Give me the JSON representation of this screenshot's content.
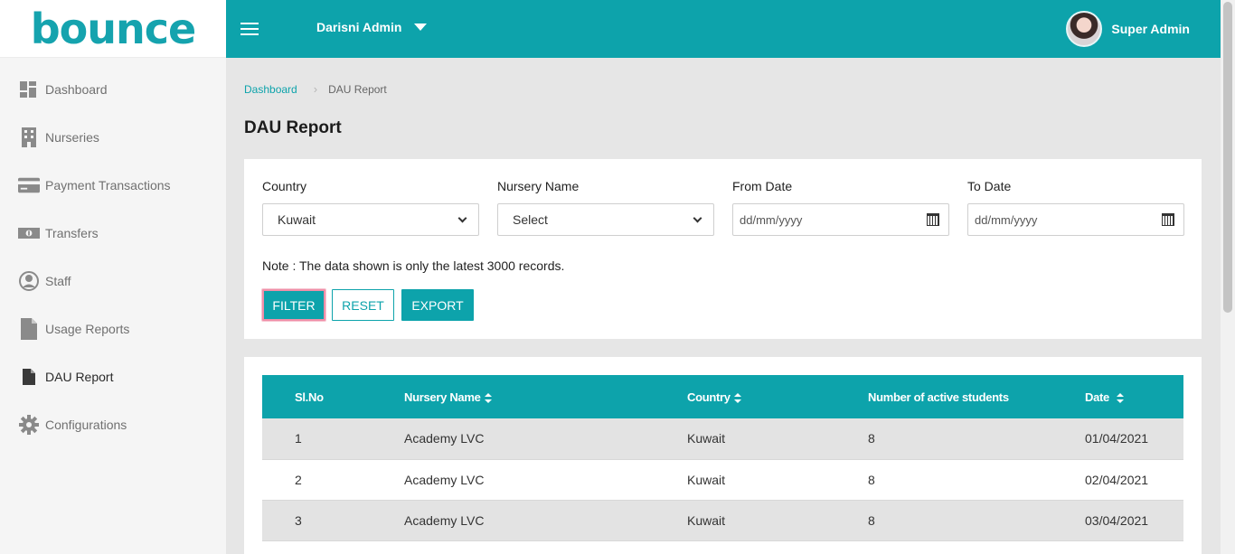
{
  "brand": {
    "logo_text": "bounce",
    "logo_color": "#15a3ae",
    "logo_dot_color": "#8cc63f"
  },
  "colors": {
    "primary": "#0da3ab",
    "sidebar_bg": "#f5f5f5",
    "page_bg": "#e6e6e6"
  },
  "sidebar": {
    "items": [
      {
        "label": "Dashboard",
        "icon": "dashboard-icon"
      },
      {
        "label": "Nurseries",
        "icon": "building-icon"
      },
      {
        "label": "Payment Transactions",
        "icon": "credit-card-icon"
      },
      {
        "label": "Transfers",
        "icon": "money-bill-icon"
      },
      {
        "label": "Staff",
        "icon": "user-circle-icon"
      },
      {
        "label": "Usage Reports",
        "icon": "file-icon"
      },
      {
        "label": "DAU Report",
        "icon": "file-icon",
        "active": true
      },
      {
        "label": "Configurations",
        "icon": "gear-icon"
      }
    ]
  },
  "topbar": {
    "org_name": "Darisni Admin",
    "user_name": "Super Admin"
  },
  "breadcrumb": {
    "home": "Dashboard",
    "current": "DAU Report"
  },
  "page": {
    "title": "DAU Report"
  },
  "filters": {
    "country": {
      "label": "Country",
      "value": "Kuwait"
    },
    "nursery": {
      "label": "Nursery Name",
      "value": "Select"
    },
    "from_date": {
      "label": "From Date",
      "placeholder": "dd/mm/yyyy"
    },
    "to_date": {
      "label": "To Date",
      "placeholder": "dd/mm/yyyy"
    },
    "note": "Note : The data shown is only the latest 3000 records.",
    "buttons": {
      "filter": "FILTER",
      "reset": "RESET",
      "export": "EXPORT"
    }
  },
  "table": {
    "headers": [
      "Sl.No",
      "Nursery Name",
      "Country",
      "Number of active students",
      "Date"
    ],
    "rows": [
      [
        "1",
        "Academy LVC",
        "Kuwait",
        "8",
        "01/04/2021"
      ],
      [
        "2",
        "Academy LVC",
        "Kuwait",
        "8",
        "02/04/2021"
      ],
      [
        "3",
        "Academy LVC",
        "Kuwait",
        "8",
        "03/04/2021"
      ]
    ]
  }
}
